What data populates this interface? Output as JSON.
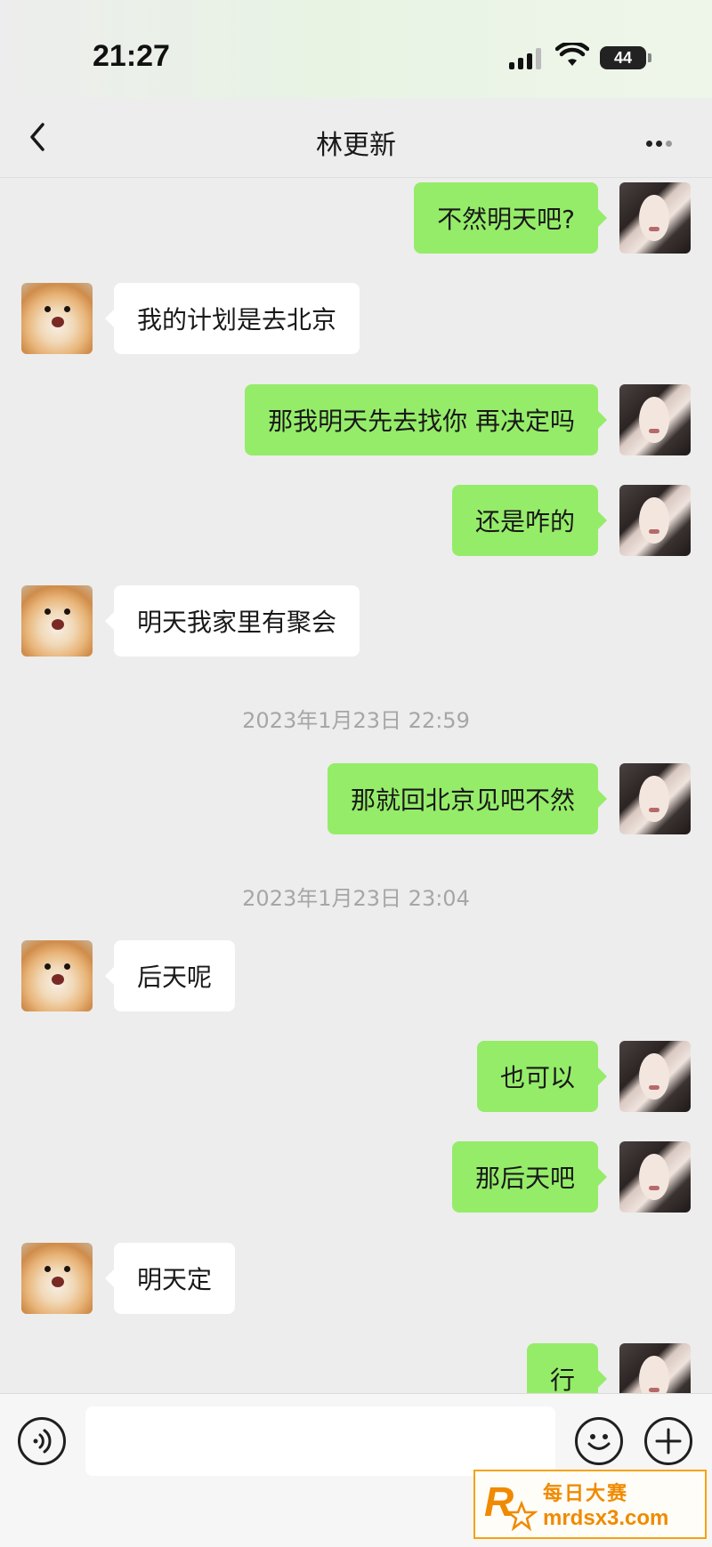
{
  "status_bar": {
    "time": "21:27",
    "battery": "44"
  },
  "nav": {
    "title": "林更新"
  },
  "messages": [
    {
      "side": "right",
      "text": "不然明天吧?"
    },
    {
      "side": "left",
      "text": "我的计划是去北京"
    },
    {
      "side": "right",
      "text": "那我明天先去找你 再决定吗"
    },
    {
      "side": "right",
      "text": "还是咋的"
    },
    {
      "side": "left",
      "text": "明天我家里有聚会"
    },
    {
      "timestamp": "2023年1月23日 22:59"
    },
    {
      "side": "right",
      "text": "那就回北京见吧不然"
    },
    {
      "timestamp": "2023年1月23日 23:04"
    },
    {
      "side": "left",
      "text": "后天呢"
    },
    {
      "side": "right",
      "text": "也可以"
    },
    {
      "side": "right",
      "text": "那后天吧"
    },
    {
      "side": "left",
      "text": "明天定"
    },
    {
      "side": "right",
      "text": "行"
    }
  ],
  "input": {
    "value": ""
  },
  "watermark": {
    "line1": "每日大赛",
    "line2": "mrdsx3.com",
    "logo_letter": "R"
  },
  "colors": {
    "sent_bubble": "#95ec69",
    "received_bubble": "#ffffff",
    "background": "#ededed",
    "watermark": "#f08a00"
  },
  "icons": {
    "back": "chevron-left-icon",
    "more": "more-dots-icon",
    "voice": "voice-icon",
    "emoji": "emoji-icon",
    "plus": "plus-icon"
  }
}
